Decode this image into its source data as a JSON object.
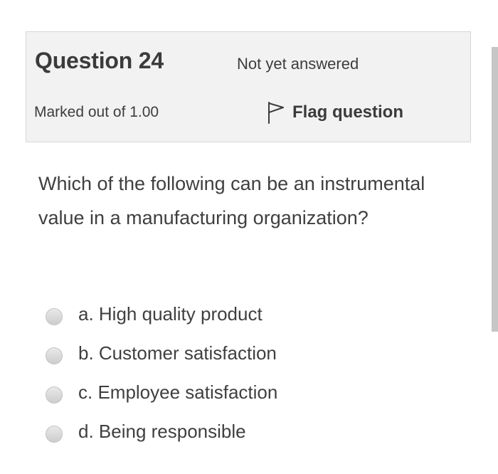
{
  "header": {
    "question_title": "Question 24",
    "state": "Not yet answered",
    "grade": "Marked out of 1.00",
    "flag_label": "Flag question"
  },
  "question": {
    "text": "Which of the following can be an instrumental value in a manufacturing organization?"
  },
  "answers": [
    {
      "label": "a. High quality product",
      "selected": false
    },
    {
      "label": "b. Customer satisfaction",
      "selected": false
    },
    {
      "label": "c. Employee satisfaction",
      "selected": false
    },
    {
      "label": "d. Being responsible",
      "selected": false
    }
  ],
  "icons": {
    "flag": "flag-icon",
    "radio": "radio-button"
  },
  "colors": {
    "info_background": "#f2f2f2",
    "info_border": "#d6d6d6",
    "text": "#3a3a3a",
    "scrollbar": "#c6c6c6"
  }
}
